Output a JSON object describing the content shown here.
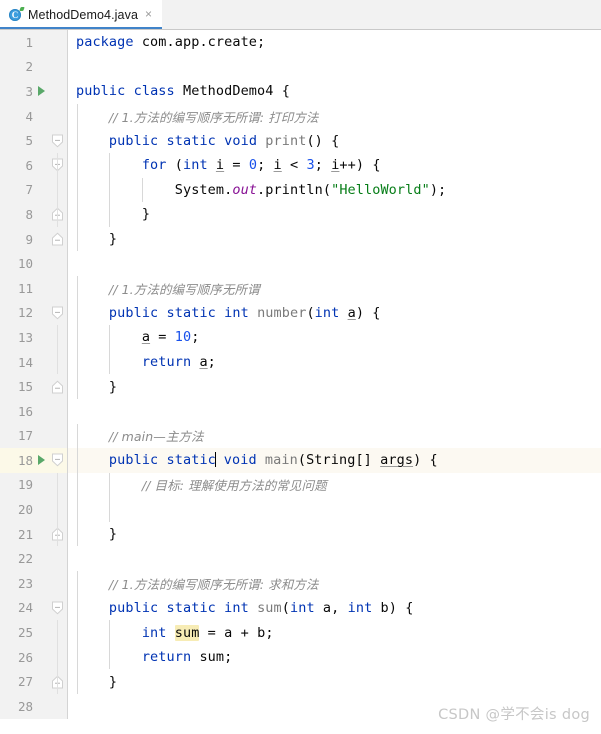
{
  "window": {
    "title": "MethodDemo4.java"
  },
  "tab": {
    "label": "MethodDemo4.java",
    "close_glyph": "×",
    "icon_letter": "C",
    "icon_name": "java-class-file-icon",
    "accent_color": "#4083c9"
  },
  "editor": {
    "language": "java",
    "current_line": 18,
    "gutter_background": "#f2f2f2",
    "current_line_highlight": "#fcf9e8",
    "usage_highlight_color": "#f7ecb5",
    "keyword_color": "#0033b3",
    "string_color": "#067d17",
    "number_color": "#1750eb",
    "comment_color": "#8c8c8c",
    "field_color": "#871094",
    "method_color": "#7a7a7a",
    "run_marker_color": "#59a869"
  },
  "watermark": {
    "text": "CSDN @学不会is dog"
  },
  "code_lines": [
    {
      "n": "1",
      "run": false,
      "fold": "none",
      "indent_guides": 0,
      "current": false,
      "tokens": [
        {
          "t": "kw",
          "v": "package"
        },
        {
          "t": "sp",
          "v": " "
        },
        {
          "t": "ident",
          "v": "com"
        },
        {
          "t": "punct",
          "v": "."
        },
        {
          "t": "ident",
          "v": "app"
        },
        {
          "t": "punct",
          "v": "."
        },
        {
          "t": "ident",
          "v": "create"
        },
        {
          "t": "punct",
          "v": ";"
        }
      ]
    },
    {
      "n": "2",
      "run": false,
      "fold": "none",
      "indent_guides": 0,
      "current": false,
      "tokens": []
    },
    {
      "n": "3",
      "run": true,
      "fold": "none",
      "indent_guides": 0,
      "current": false,
      "tokens": [
        {
          "t": "kw",
          "v": "public"
        },
        {
          "t": "sp",
          "v": " "
        },
        {
          "t": "kw",
          "v": "class"
        },
        {
          "t": "sp",
          "v": " "
        },
        {
          "t": "cls",
          "v": "MethodDemo4"
        },
        {
          "t": "sp",
          "v": " "
        },
        {
          "t": "punct",
          "v": "{"
        }
      ]
    },
    {
      "n": "4",
      "run": false,
      "fold": "none",
      "indent_guides": 1,
      "current": false,
      "tokens": [
        {
          "t": "sp",
          "v": "    "
        },
        {
          "t": "cmt",
          "v": "// 1.方法的编写顺序无所谓: 打印方法"
        }
      ]
    },
    {
      "n": "5",
      "run": false,
      "fold": "open",
      "indent_guides": 1,
      "current": false,
      "tokens": [
        {
          "t": "sp",
          "v": "    "
        },
        {
          "t": "kw",
          "v": "public"
        },
        {
          "t": "sp",
          "v": " "
        },
        {
          "t": "kw",
          "v": "static"
        },
        {
          "t": "sp",
          "v": " "
        },
        {
          "t": "kw",
          "v": "void"
        },
        {
          "t": "sp",
          "v": " "
        },
        {
          "t": "method",
          "v": "print"
        },
        {
          "t": "punct",
          "v": "() {"
        }
      ]
    },
    {
      "n": "6",
      "run": false,
      "fold": "open",
      "indent_guides": 2,
      "current": false,
      "tokens": [
        {
          "t": "sp",
          "v": "        "
        },
        {
          "t": "kw",
          "v": "for"
        },
        {
          "t": "sp",
          "v": " "
        },
        {
          "t": "punct",
          "v": "("
        },
        {
          "t": "kw",
          "v": "int"
        },
        {
          "t": "sp",
          "v": " "
        },
        {
          "t": "param",
          "v": "i"
        },
        {
          "t": "sp",
          "v": " "
        },
        {
          "t": "punct",
          "v": "="
        },
        {
          "t": "sp",
          "v": " "
        },
        {
          "t": "num",
          "v": "0"
        },
        {
          "t": "punct",
          "v": ";"
        },
        {
          "t": "sp",
          "v": " "
        },
        {
          "t": "param",
          "v": "i"
        },
        {
          "t": "sp",
          "v": " "
        },
        {
          "t": "punct",
          "v": "<"
        },
        {
          "t": "sp",
          "v": " "
        },
        {
          "t": "num",
          "v": "3"
        },
        {
          "t": "punct",
          "v": ";"
        },
        {
          "t": "sp",
          "v": " "
        },
        {
          "t": "param",
          "v": "i"
        },
        {
          "t": "punct",
          "v": "++) {"
        }
      ]
    },
    {
      "n": "7",
      "run": false,
      "fold": "none",
      "indent_guides": 3,
      "current": false,
      "tokens": [
        {
          "t": "sp",
          "v": "            "
        },
        {
          "t": "cls",
          "v": "System"
        },
        {
          "t": "punct",
          "v": "."
        },
        {
          "t": "field",
          "v": "out"
        },
        {
          "t": "punct",
          "v": "."
        },
        {
          "t": "ident",
          "v": "println"
        },
        {
          "t": "punct",
          "v": "("
        },
        {
          "t": "str",
          "v": "\"HelloWorld\""
        },
        {
          "t": "punct",
          "v": ");"
        }
      ]
    },
    {
      "n": "8",
      "run": false,
      "fold": "close",
      "indent_guides": 2,
      "current": false,
      "tokens": [
        {
          "t": "sp",
          "v": "        "
        },
        {
          "t": "punct",
          "v": "}"
        }
      ]
    },
    {
      "n": "9",
      "run": false,
      "fold": "close",
      "indent_guides": 1,
      "current": false,
      "tokens": [
        {
          "t": "sp",
          "v": "    "
        },
        {
          "t": "punct",
          "v": "}"
        }
      ]
    },
    {
      "n": "10",
      "run": false,
      "fold": "none",
      "indent_guides": 0,
      "current": false,
      "tokens": []
    },
    {
      "n": "11",
      "run": false,
      "fold": "none",
      "indent_guides": 1,
      "current": false,
      "tokens": [
        {
          "t": "sp",
          "v": "    "
        },
        {
          "t": "cmt",
          "v": "// 1.方法的编写顺序无所谓"
        }
      ]
    },
    {
      "n": "12",
      "run": false,
      "fold": "open",
      "indent_guides": 1,
      "current": false,
      "tokens": [
        {
          "t": "sp",
          "v": "    "
        },
        {
          "t": "kw",
          "v": "public"
        },
        {
          "t": "sp",
          "v": " "
        },
        {
          "t": "kw",
          "v": "static"
        },
        {
          "t": "sp",
          "v": " "
        },
        {
          "t": "kw",
          "v": "int"
        },
        {
          "t": "sp",
          "v": " "
        },
        {
          "t": "method",
          "v": "number"
        },
        {
          "t": "punct",
          "v": "("
        },
        {
          "t": "kw",
          "v": "int"
        },
        {
          "t": "sp",
          "v": " "
        },
        {
          "t": "param",
          "v": "a"
        },
        {
          "t": "punct",
          "v": ") {"
        }
      ]
    },
    {
      "n": "13",
      "run": false,
      "fold": "none",
      "indent_guides": 2,
      "current": false,
      "tokens": [
        {
          "t": "sp",
          "v": "        "
        },
        {
          "t": "param",
          "v": "a"
        },
        {
          "t": "sp",
          "v": " "
        },
        {
          "t": "punct",
          "v": "="
        },
        {
          "t": "sp",
          "v": " "
        },
        {
          "t": "num",
          "v": "10"
        },
        {
          "t": "punct",
          "v": ";"
        }
      ]
    },
    {
      "n": "14",
      "run": false,
      "fold": "none",
      "indent_guides": 2,
      "current": false,
      "tokens": [
        {
          "t": "sp",
          "v": "        "
        },
        {
          "t": "kw",
          "v": "return"
        },
        {
          "t": "sp",
          "v": " "
        },
        {
          "t": "param",
          "v": "a"
        },
        {
          "t": "punct",
          "v": ";"
        }
      ]
    },
    {
      "n": "15",
      "run": false,
      "fold": "close",
      "indent_guides": 1,
      "current": false,
      "tokens": [
        {
          "t": "sp",
          "v": "    "
        },
        {
          "t": "punct",
          "v": "}"
        }
      ]
    },
    {
      "n": "16",
      "run": false,
      "fold": "none",
      "indent_guides": 0,
      "current": false,
      "tokens": []
    },
    {
      "n": "17",
      "run": false,
      "fold": "none",
      "indent_guides": 1,
      "current": false,
      "tokens": [
        {
          "t": "sp",
          "v": "    "
        },
        {
          "t": "cmt",
          "v": "// main—主方法"
        }
      ]
    },
    {
      "n": "18",
      "run": true,
      "fold": "open",
      "indent_guides": 1,
      "current": true,
      "tokens": [
        {
          "t": "sp",
          "v": "    "
        },
        {
          "t": "kw",
          "v": "public"
        },
        {
          "t": "sp",
          "v": " "
        },
        {
          "t": "kw",
          "v": "static"
        },
        {
          "t": "caret",
          "v": ""
        },
        {
          "t": "sp",
          "v": " "
        },
        {
          "t": "kw",
          "v": "void"
        },
        {
          "t": "sp",
          "v": " "
        },
        {
          "t": "method",
          "v": "main"
        },
        {
          "t": "punct",
          "v": "("
        },
        {
          "t": "cls",
          "v": "String"
        },
        {
          "t": "punct",
          "v": "[] "
        },
        {
          "t": "param",
          "v": "args"
        },
        {
          "t": "punct",
          "v": ") {"
        }
      ]
    },
    {
      "n": "19",
      "run": false,
      "fold": "none",
      "indent_guides": 2,
      "current": false,
      "tokens": [
        {
          "t": "sp",
          "v": "        "
        },
        {
          "t": "cmt",
          "v": "// 目标: 理解使用方法的常见问题"
        }
      ]
    },
    {
      "n": "20",
      "run": false,
      "fold": "none",
      "indent_guides": 2,
      "current": false,
      "tokens": []
    },
    {
      "n": "21",
      "run": false,
      "fold": "close",
      "indent_guides": 1,
      "current": false,
      "tokens": [
        {
          "t": "sp",
          "v": "    "
        },
        {
          "t": "punct",
          "v": "}"
        }
      ]
    },
    {
      "n": "22",
      "run": false,
      "fold": "none",
      "indent_guides": 0,
      "current": false,
      "tokens": []
    },
    {
      "n": "23",
      "run": false,
      "fold": "none",
      "indent_guides": 1,
      "current": false,
      "tokens": [
        {
          "t": "sp",
          "v": "    "
        },
        {
          "t": "cmt",
          "v": "// 1.方法的编写顺序无所谓: 求和方法"
        }
      ]
    },
    {
      "n": "24",
      "run": false,
      "fold": "open",
      "indent_guides": 1,
      "current": false,
      "tokens": [
        {
          "t": "sp",
          "v": "    "
        },
        {
          "t": "kw",
          "v": "public"
        },
        {
          "t": "sp",
          "v": " "
        },
        {
          "t": "kw",
          "v": "static"
        },
        {
          "t": "sp",
          "v": " "
        },
        {
          "t": "kw",
          "v": "int"
        },
        {
          "t": "sp",
          "v": " "
        },
        {
          "t": "method",
          "v": "sum"
        },
        {
          "t": "punct",
          "v": "("
        },
        {
          "t": "kw",
          "v": "int"
        },
        {
          "t": "sp",
          "v": " "
        },
        {
          "t": "ident",
          "v": "a"
        },
        {
          "t": "punct",
          "v": ", "
        },
        {
          "t": "kw",
          "v": "int"
        },
        {
          "t": "sp",
          "v": " "
        },
        {
          "t": "ident",
          "v": "b"
        },
        {
          "t": "punct",
          "v": ") {"
        }
      ]
    },
    {
      "n": "25",
      "run": false,
      "fold": "none",
      "indent_guides": 2,
      "current": false,
      "tokens": [
        {
          "t": "sp",
          "v": "        "
        },
        {
          "t": "kw",
          "v": "int"
        },
        {
          "t": "sp",
          "v": " "
        },
        {
          "t": "hl",
          "v": "sum"
        },
        {
          "t": "sp",
          "v": " "
        },
        {
          "t": "punct",
          "v": "="
        },
        {
          "t": "sp",
          "v": " "
        },
        {
          "t": "ident",
          "v": "a"
        },
        {
          "t": "sp",
          "v": " "
        },
        {
          "t": "punct",
          "v": "+"
        },
        {
          "t": "sp",
          "v": " "
        },
        {
          "t": "ident",
          "v": "b"
        },
        {
          "t": "punct",
          "v": ";"
        }
      ]
    },
    {
      "n": "26",
      "run": false,
      "fold": "none",
      "indent_guides": 2,
      "current": false,
      "tokens": [
        {
          "t": "sp",
          "v": "        "
        },
        {
          "t": "kw",
          "v": "return"
        },
        {
          "t": "sp",
          "v": " "
        },
        {
          "t": "ident",
          "v": "sum"
        },
        {
          "t": "punct",
          "v": ";"
        }
      ]
    },
    {
      "n": "27",
      "run": false,
      "fold": "close",
      "indent_guides": 1,
      "current": false,
      "tokens": [
        {
          "t": "sp",
          "v": "    "
        },
        {
          "t": "punct",
          "v": "}"
        }
      ]
    },
    {
      "n": "28",
      "run": false,
      "fold": "none",
      "indent_guides": 0,
      "current": false,
      "tokens": []
    }
  ]
}
